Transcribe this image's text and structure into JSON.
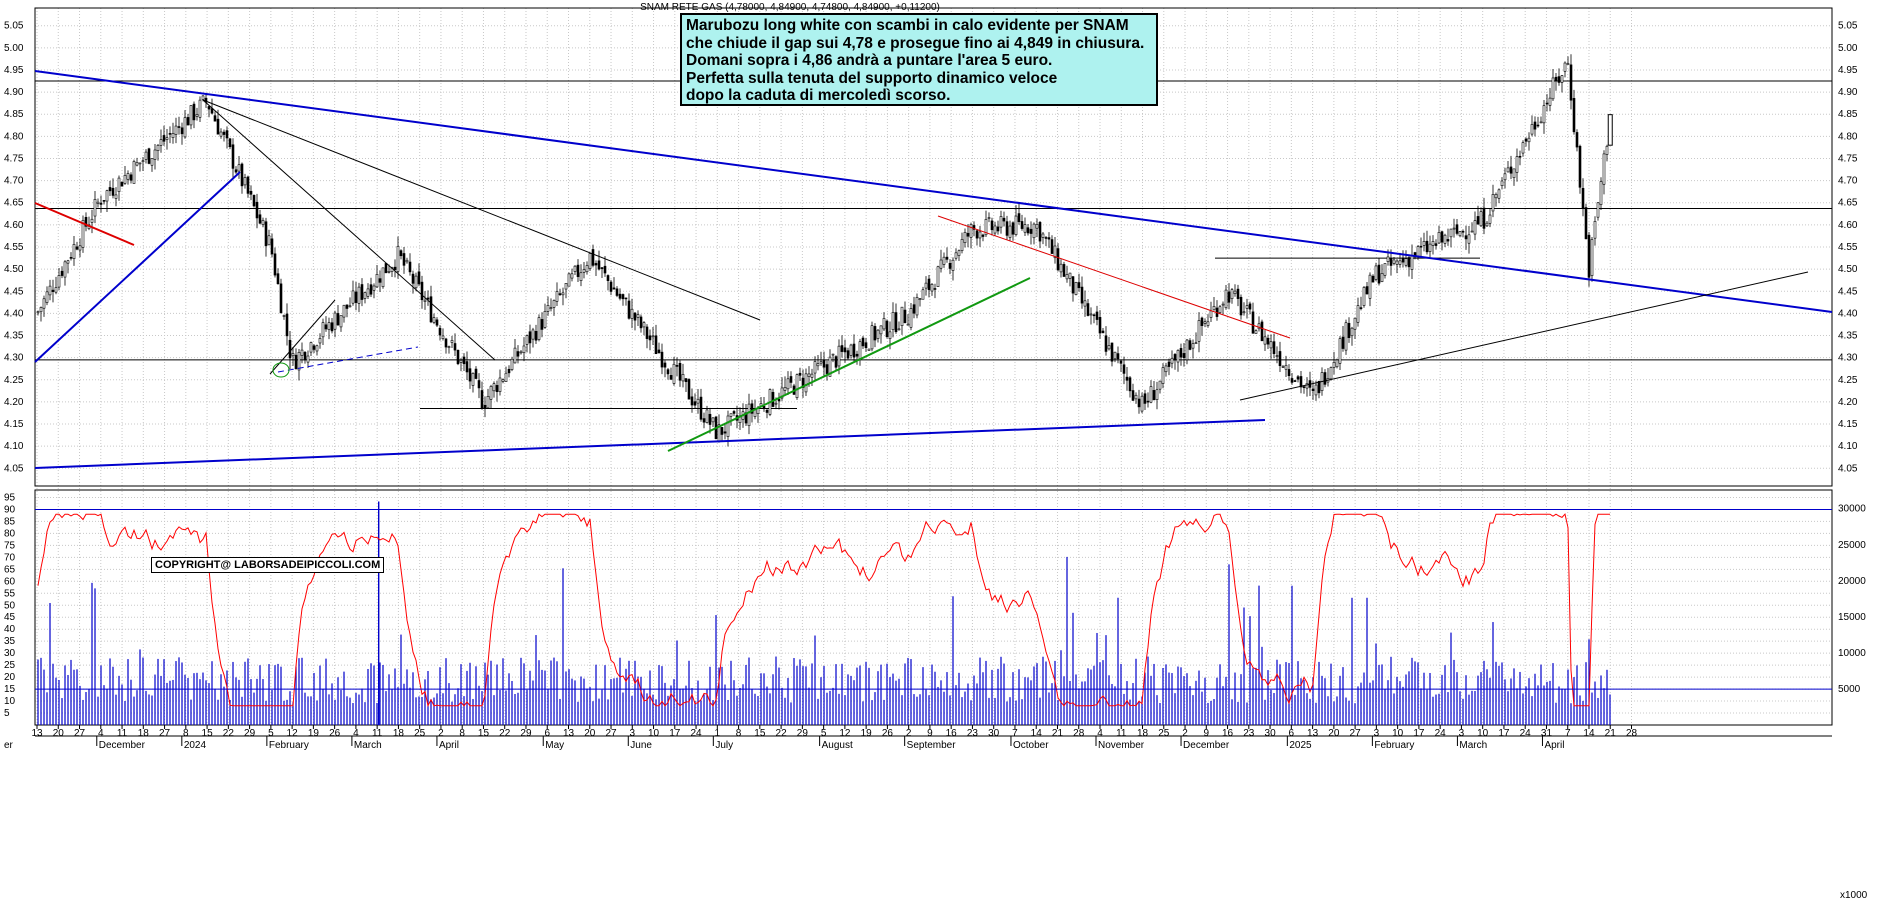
{
  "header": {
    "title": "SNAM RETE GAS (4,78000, 4,84900, 4,74800, 4,84900, +0,11200)"
  },
  "annotation": {
    "lines": [
      "Marubozu long white con scambi in calo evidente per SNAM",
      "che chiude il gap sui 4,78 e prosegue fino ai 4,849 in chiusura.",
      "Domani sopra i 4,86 andrà a puntare l'area 5 euro.",
      "Perfetta sulla tenuta del supporto dinamico veloce",
      "dopo la caduta di mercoledì scorso."
    ]
  },
  "copyright": "COPYRIGHT@ LABORSADEIPICCOLI.COM",
  "volume_unit_label": "x1000",
  "colors": {
    "candle": "#000000",
    "trend_blue": "#0000cc",
    "trend_red": "#dd0000",
    "trend_green": "#119911",
    "rsi_line": "#ff0000",
    "volume_bar": "#0000cc",
    "grid": "#c8c8c8"
  },
  "chart_data": [
    {
      "type": "candlestick",
      "title": "SNAM RETE GAS (4,78000, 4,84900, 4,74800, 4,84900, +0,11200)",
      "ylim": [
        4.01,
        5.09
      ],
      "y_ticks": [
        "4.05",
        "4.10",
        "4.15",
        "4.20",
        "4.25",
        "4.30",
        "4.35",
        "4.40",
        "4.45",
        "4.50",
        "4.55",
        "4.60",
        "4.65",
        "4.70",
        "4.75",
        "4.80",
        "4.85",
        "4.90",
        "4.95",
        "5.00",
        "5.05"
      ],
      "last_bar": {
        "open": 4.78,
        "high": 4.849,
        "low": 4.748,
        "close": 4.849,
        "change": 0.112
      },
      "key_closes": [
        {
          "date": "2023-11-13",
          "close": 4.4
        },
        {
          "date": "2023-12-04",
          "close": 4.66
        },
        {
          "date": "2024-01-08",
          "close": 4.88
        },
        {
          "date": "2024-01-29",
          "close": 4.55
        },
        {
          "date": "2024-02-05",
          "close": 4.29
        },
        {
          "date": "2024-03-11",
          "close": 4.53
        },
        {
          "date": "2024-04-08",
          "close": 4.2
        },
        {
          "date": "2024-05-13",
          "close": 4.53
        },
        {
          "date": "2024-06-24",
          "close": 4.13
        },
        {
          "date": "2024-08-26",
          "close": 4.4
        },
        {
          "date": "2024-09-16",
          "close": 4.59
        },
        {
          "date": "2024-10-07",
          "close": 4.6
        },
        {
          "date": "2024-11-11",
          "close": 4.19
        },
        {
          "date": "2024-12-09",
          "close": 4.45
        },
        {
          "date": "2025-01-06",
          "close": 4.21
        },
        {
          "date": "2025-01-27",
          "close": 4.49
        },
        {
          "date": "2025-03-03",
          "close": 4.61
        },
        {
          "date": "2025-03-31",
          "close": 4.97
        },
        {
          "date": "2025-04-07",
          "close": 4.5
        },
        {
          "date": "2025-04-14",
          "close": 4.849
        }
      ],
      "horizontal_levels": [
        4.925,
        4.637,
        4.295,
        4.185,
        4.525
      ],
      "grid": true
    },
    {
      "type": "line",
      "name": "oscillator",
      "ylim": [
        0,
        90
      ],
      "y_ticks": [
        "5",
        "10",
        "15",
        "20",
        "25",
        "30",
        "35",
        "40",
        "45",
        "50",
        "55",
        "60",
        "65",
        "70",
        "75",
        "80",
        "85",
        "90",
        "95"
      ],
      "reference_levels": [
        90,
        15
      ]
    },
    {
      "type": "bar",
      "name": "volume",
      "unit": "x1000",
      "ylim": [
        0,
        31000
      ],
      "y_ticks": [
        "5000",
        "10000",
        "15000",
        "20000",
        "25000",
        "30000"
      ]
    }
  ],
  "x_axis": {
    "day_ticks": [
      "13",
      "20",
      "27",
      "4",
      "11",
      "18",
      "27",
      "8",
      "15",
      "22",
      "29",
      "5",
      "12",
      "19",
      "26",
      "4",
      "11",
      "18",
      "25",
      "2",
      "8",
      "15",
      "22",
      "29",
      "6",
      "13",
      "20",
      "27",
      "3",
      "10",
      "17",
      "24",
      "1",
      "8",
      "15",
      "22",
      "29",
      "5",
      "12",
      "19",
      "26",
      "2",
      "9",
      "16",
      "23",
      "30",
      "7",
      "14",
      "21",
      "28",
      "4",
      "11",
      "18",
      "25",
      "2",
      "9",
      "16",
      "23",
      "30",
      "6",
      "13",
      "20",
      "27",
      "3",
      "10",
      "17",
      "24",
      "3",
      "10",
      "17",
      "24",
      "31",
      "7",
      "14",
      "21",
      "28"
    ],
    "month_labels": [
      "er",
      "December",
      "2024",
      "February",
      "March",
      "April",
      "May",
      "June",
      "July",
      "August",
      "September",
      "October",
      "November",
      "December",
      "2025",
      "February",
      "March",
      "April"
    ]
  }
}
